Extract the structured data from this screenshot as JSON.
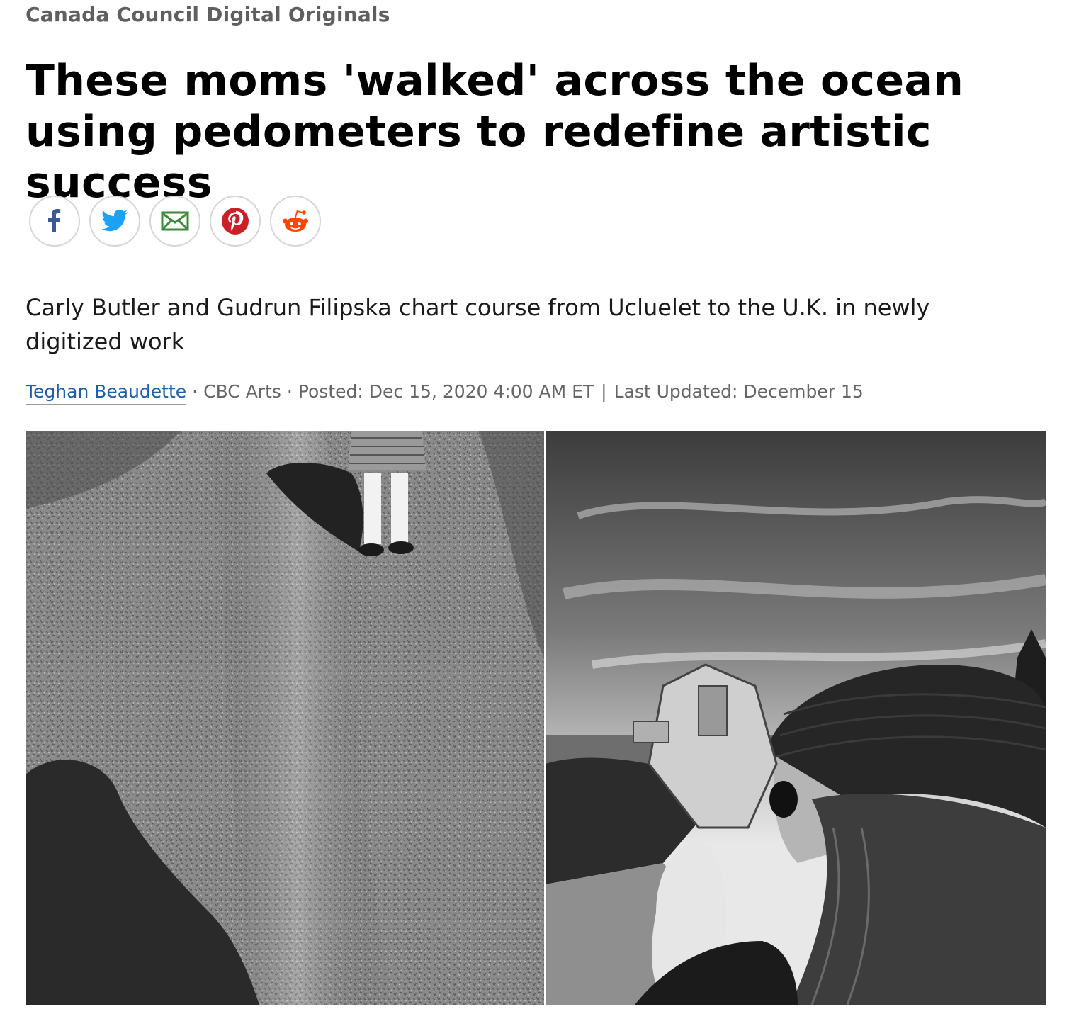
{
  "header": {
    "kicker": "Canada Council Digital Originals"
  },
  "article": {
    "headline": "These moms 'walked' across the ocean using pedometers to redefine artistic success",
    "dek": "Carly Butler and Gudrun Filipska chart course from Ucluelet to the U.K. in newly digitized work",
    "byline": {
      "author": "Teghan Beaudette",
      "section": "CBC Arts",
      "posted": "Posted: Dec 15, 2020 4:00 AM ET",
      "updated": "Last Updated: December 15"
    }
  },
  "share": [
    {
      "name": "facebook",
      "icon": "facebook-icon",
      "color": "#3b5998"
    },
    {
      "name": "twitter",
      "icon": "twitter-icon",
      "color": "#1da1f2"
    },
    {
      "name": "email",
      "icon": "email-icon",
      "color": "#3b8a3a"
    },
    {
      "name": "pinterest",
      "icon": "pinterest-icon",
      "color": "#cb2027"
    },
    {
      "name": "reddit",
      "icon": "reddit-icon",
      "color": "#ff4500"
    }
  ],
  "colors": {
    "kicker": "#5f5f5f",
    "author_link": "#1d5fa8",
    "meta_text": "#666666"
  }
}
